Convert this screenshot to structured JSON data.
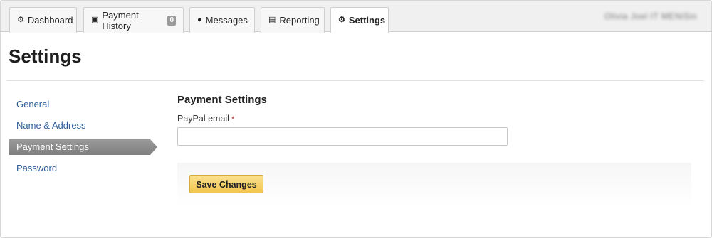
{
  "nav": {
    "tabs": [
      {
        "label": "Dashboard",
        "icon": "dashboard-icon",
        "active": false
      },
      {
        "label": "Payment History",
        "icon": "money-icon",
        "badge": "0",
        "active": false
      },
      {
        "label": "Messages",
        "icon": "chat-icon",
        "active": false
      },
      {
        "label": "Reporting",
        "icon": "bar-chart-icon",
        "active": false
      },
      {
        "label": "Settings",
        "icon": "gear-icon",
        "active": true
      }
    ],
    "user_blurred": "Olivia Joel IT MENiSin"
  },
  "page": {
    "title": "Settings"
  },
  "sidebar": {
    "items": [
      {
        "label": "General",
        "active": false
      },
      {
        "label": "Name & Address",
        "active": false
      },
      {
        "label": "Payment Settings",
        "active": true
      },
      {
        "label": "Password",
        "active": false
      }
    ]
  },
  "form": {
    "section_title": "Payment Settings",
    "paypal_label": "PayPal email",
    "required_mark": "*",
    "paypal_value": "",
    "save_label": "Save Changes"
  },
  "colors": {
    "link": "#2f5f9a",
    "button": "#f3c54e",
    "active_side": "#8a8a8a"
  }
}
